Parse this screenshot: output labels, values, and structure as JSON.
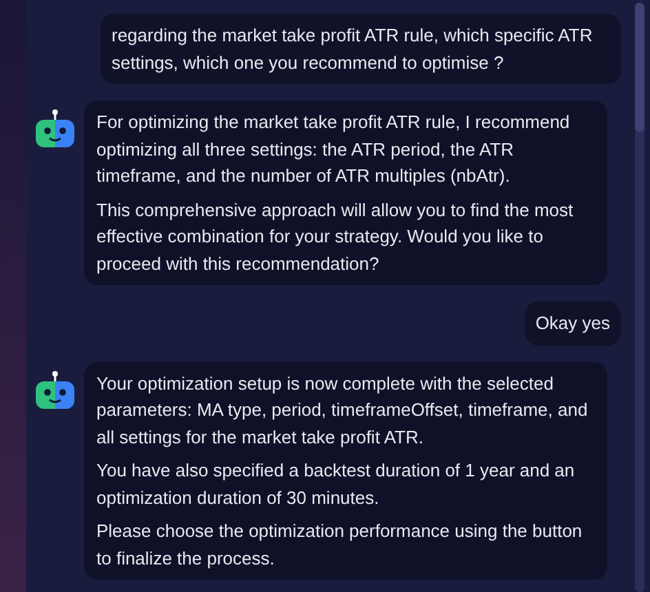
{
  "messages": [
    {
      "kind": "user",
      "paragraphs": [
        "regarding the market take profit ATR rule, which specific ATR settings, which one you recommend to optimise ?"
      ]
    },
    {
      "kind": "bot",
      "paragraphs": [
        "For optimizing the market take profit ATR rule, I recommend optimizing all three settings: the ATR period, the ATR timeframe, and the number of ATR multiples (nbAtr).",
        "This comprehensive approach will allow you to find the most effective combination for your strategy. Would you like to proceed with this recommendation?"
      ]
    },
    {
      "kind": "user",
      "paragraphs": [
        "Okay yes"
      ]
    },
    {
      "kind": "bot",
      "paragraphs": [
        "Your optimization setup is now complete with the selected parameters: MA type, period, timeframeOffset, timeframe, and all settings for the market take profit ATR.",
        "You have also specified a backtest duration of 1 year and an optimization duration of 30 minutes.",
        "Please choose the optimization performance using the button to finalize the process."
      ]
    }
  ]
}
